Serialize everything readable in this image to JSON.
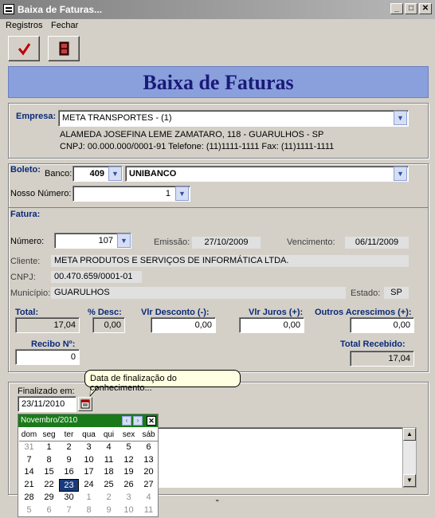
{
  "window": {
    "title": "Baixa de Faturas...",
    "minimize": "_",
    "maximize": "□",
    "close": "✕"
  },
  "menu": {
    "items": [
      "Registros",
      "Fechar"
    ]
  },
  "toolbar": {
    "confirm_icon": "checkmark-icon",
    "exit_icon": "exit-door-icon"
  },
  "banner": {
    "title": "Baixa de Faturas"
  },
  "empresa": {
    "label": "Empresa:",
    "value": "META TRANSPORTES - (1)",
    "address": "ALAMEDA JOSEFINA LEME ZAMATARO, 118 - GUARULHOS - SP",
    "contact": "CNPJ: 00.000.000/0001-91 Telefone: (11)1111-1111 Fax: (11)1111-1111"
  },
  "boleto": {
    "label": "Boleto:",
    "banco_label": "Banco:",
    "banco_code": "409",
    "banco_name": "UNIBANCO",
    "nosso_numero_label": "Nosso Número:",
    "nosso_numero": "1"
  },
  "fatura": {
    "label": "Fatura:",
    "numero_label": "Número:",
    "numero": "107",
    "emissao_label": "Emissão:",
    "emissao": "27/10/2009",
    "vencimento_label": "Vencimento:",
    "vencimento": "06/11/2009",
    "cliente_label": "Cliente:",
    "cliente": "META PRODUTOS E SERVIÇOS DE INFORMÁTICA LTDA.",
    "cnpj_label": "CNPJ:",
    "cnpj": "00.470.659/0001-01",
    "municipio_label": "Município:",
    "municipio": "GUARULHOS",
    "estado_label": "Estado:",
    "estado": "SP"
  },
  "valores": {
    "total_label": "Total:",
    "total": "17,04",
    "desc_label": "% Desc:",
    "desc": "0,00",
    "vlr_desc_label": "Vlr Desconto (-):",
    "vlr_desc": "0,00",
    "juros_label": "Vlr Juros (+):",
    "juros": "0,00",
    "outros_label": "Outros Acrescimos (+):",
    "outros": "0,00",
    "recibo_label": "Recibo Nº:",
    "recibo": "0",
    "total_recebido_label": "Total Recebido:",
    "total_recebido": "17,04"
  },
  "finalizacao": {
    "label": "Finalizado em:",
    "date": "23/11/2010",
    "tooltip": "Data de finalização do conhecimento..."
  },
  "calendar": {
    "month_label": "Novembro/2010",
    "prev": "‹",
    "next": "›",
    "close": "✕",
    "weekdays": [
      "dom",
      "seg",
      "ter",
      "qua",
      "qui",
      "sex",
      "sáb"
    ],
    "weeks": [
      [
        {
          "d": "31",
          "o": true
        },
        {
          "d": "1"
        },
        {
          "d": "2"
        },
        {
          "d": "3"
        },
        {
          "d": "4"
        },
        {
          "d": "5"
        },
        {
          "d": "6"
        }
      ],
      [
        {
          "d": "7"
        },
        {
          "d": "8"
        },
        {
          "d": "9"
        },
        {
          "d": "10"
        },
        {
          "d": "11"
        },
        {
          "d": "12"
        },
        {
          "d": "13"
        }
      ],
      [
        {
          "d": "14"
        },
        {
          "d": "15"
        },
        {
          "d": "16"
        },
        {
          "d": "17"
        },
        {
          "d": "18"
        },
        {
          "d": "19"
        },
        {
          "d": "20"
        }
      ],
      [
        {
          "d": "21"
        },
        {
          "d": "22"
        },
        {
          "d": "23",
          "s": true
        },
        {
          "d": "24"
        },
        {
          "d": "25"
        },
        {
          "d": "26"
        },
        {
          "d": "27"
        }
      ],
      [
        {
          "d": "28"
        },
        {
          "d": "29"
        },
        {
          "d": "30"
        },
        {
          "d": "1",
          "o": true
        },
        {
          "d": "2",
          "o": true
        },
        {
          "d": "3",
          "o": true
        },
        {
          "d": "4",
          "o": true
        }
      ],
      [
        {
          "d": "5",
          "o": true
        },
        {
          "d": "6",
          "o": true
        },
        {
          "d": "7",
          "o": true
        },
        {
          "d": "8",
          "o": true
        },
        {
          "d": "9",
          "o": true
        },
        {
          "d": "10",
          "o": true
        },
        {
          "d": "11",
          "o": true
        }
      ]
    ]
  },
  "colors": {
    "banner_bg": "#8aa0dc",
    "banner_text": "#1a1a78",
    "label_blue": "#0a2a78",
    "calendar_header": "#1a7a1a"
  }
}
